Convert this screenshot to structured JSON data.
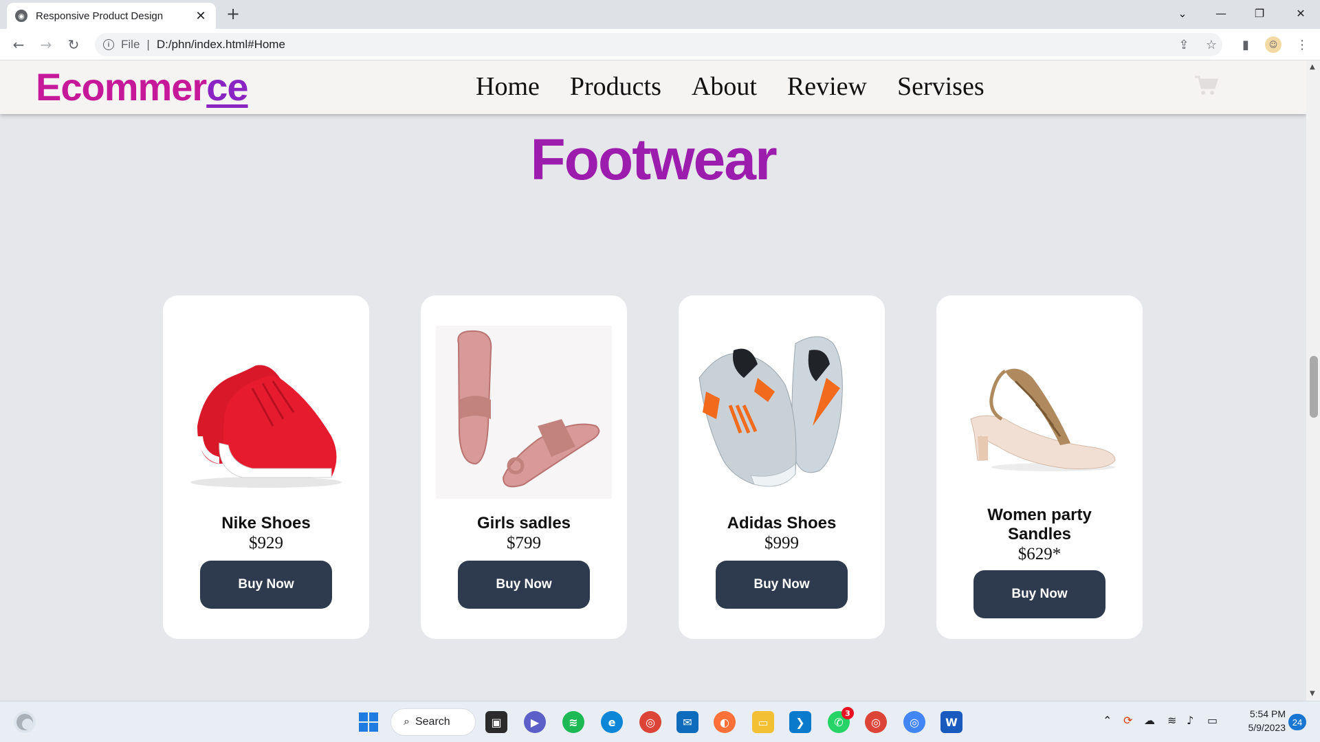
{
  "browser": {
    "tab_title": "Responsive Product Design",
    "address_scheme": "File",
    "address_url": "D:/phn/index.html#Home"
  },
  "site": {
    "logo_main": "Ecommer",
    "logo_tail": "ce",
    "nav": [
      "Home",
      "Products",
      "About",
      "Review",
      "Servises"
    ],
    "section_title": "Footwear"
  },
  "products": [
    {
      "name": "Nike Shoes",
      "price": "$929",
      "button": "Buy Now",
      "image": "red-sneakers"
    },
    {
      "name": "Girls sadles",
      "price": "$799",
      "button": "Buy Now",
      "image": "pink-sandals"
    },
    {
      "name": "Adidas Shoes",
      "price": "$999",
      "button": "Buy Now",
      "image": "grey-orange-sneakers"
    },
    {
      "name": "Women party Sandles",
      "price": "$629*",
      "button": "Buy Now",
      "image": "embellished-heel-sandal"
    }
  ],
  "taskbar": {
    "search_label": "Search",
    "time": "5:54 PM",
    "date": "5/9/2023",
    "notification_count": "24",
    "whatsapp_badge": "3"
  },
  "colors": {
    "logo": "#c5199a",
    "logo_tail": "#8a25c4",
    "section_title": "#9c1dad",
    "button": "#2e3a4d",
    "page_bg": "#e6e7eb"
  }
}
